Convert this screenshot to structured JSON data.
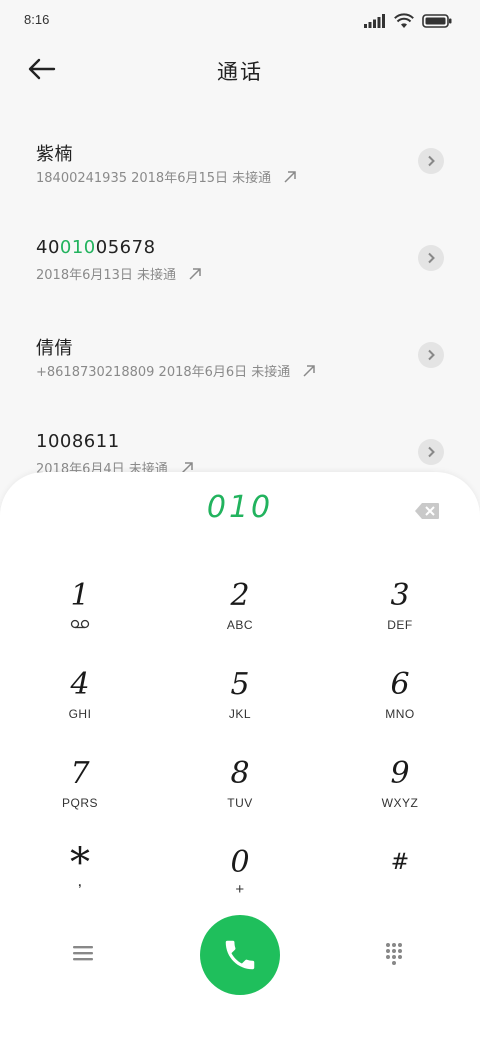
{
  "status_bar": {
    "time": "8:16"
  },
  "header": {
    "title": "通话"
  },
  "calls": [
    {
      "name": "紫楠",
      "name_parts": null,
      "detail": "18400241935 2018年6月15日 未接通"
    },
    {
      "name": "4001005678",
      "name_parts": {
        "pre": "40",
        "match": "010",
        "post": "05678"
      },
      "detail": "2018年6月13日 未接通"
    },
    {
      "name": "倩倩",
      "name_parts": null,
      "detail": "+8618730218809 2018年6月6日 未接通"
    },
    {
      "name": "1008611",
      "name_parts": null,
      "detail": "2018年6月4日 未接通"
    }
  ],
  "dialpad": {
    "number": "010",
    "keys": [
      {
        "digit": "1",
        "letters": ""
      },
      {
        "digit": "2",
        "letters": "ABC"
      },
      {
        "digit": "3",
        "letters": "DEF"
      },
      {
        "digit": "4",
        "letters": "GHI"
      },
      {
        "digit": "5",
        "letters": "JKL"
      },
      {
        "digit": "6",
        "letters": "MNO"
      },
      {
        "digit": "7",
        "letters": "PQRS"
      },
      {
        "digit": "8",
        "letters": "TUV"
      },
      {
        "digit": "9",
        "letters": "WXYZ"
      },
      {
        "digit": "*",
        "letters": ","
      },
      {
        "digit": "0",
        "letters": "+"
      },
      {
        "digit": "#",
        "letters": ""
      }
    ]
  },
  "colors": {
    "accent": "#22b35e",
    "call_button": "#1fbf5c"
  },
  "icons": [
    "back-arrow-icon",
    "signal-icon",
    "wifi-icon",
    "battery-icon",
    "outgoing-call-icon",
    "chevron-right-icon",
    "backspace-icon",
    "voicemail-icon",
    "menu-icon",
    "phone-icon",
    "keypad-icon"
  ]
}
